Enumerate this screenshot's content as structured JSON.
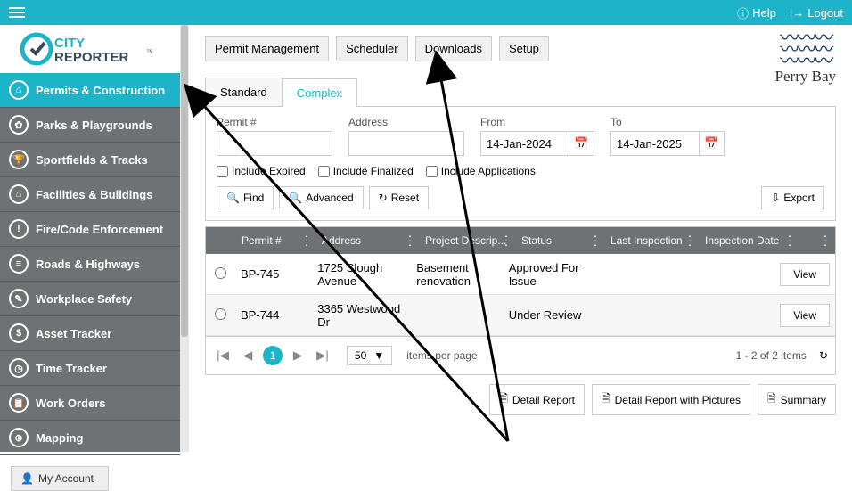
{
  "topbar": {
    "help": "Help",
    "logout": "Logout"
  },
  "brand": {
    "line1": "CITY",
    "line2": "REPORTER",
    "tm": "™"
  },
  "sidebar": {
    "items": [
      {
        "label": "Permits & Construction",
        "icon": "⌂",
        "active": true
      },
      {
        "label": "Parks & Playgrounds",
        "icon": "✿"
      },
      {
        "label": "Sportfields & Tracks",
        "icon": "🏆"
      },
      {
        "label": "Facilities & Buildings",
        "icon": "⌂"
      },
      {
        "label": "Fire/Code Enforcement",
        "icon": "!"
      },
      {
        "label": "Roads & Highways",
        "icon": "≡"
      },
      {
        "label": "Workplace Safety",
        "icon": "✎"
      },
      {
        "label": "Asset Tracker",
        "icon": "$"
      },
      {
        "label": "Time Tracker",
        "icon": "◷"
      },
      {
        "label": "Work Orders",
        "icon": "📋"
      },
      {
        "label": "Mapping",
        "icon": "⊕"
      }
    ],
    "my_account": "My Account"
  },
  "org": {
    "name": "Perry Bay"
  },
  "top_buttons": {
    "permit_mgmt": "Permit Management",
    "scheduler": "Scheduler",
    "downloads": "Downloads",
    "setup": "Setup"
  },
  "tabs": {
    "standard": "Standard",
    "complex": "Complex"
  },
  "filters": {
    "permit_label": "Permit #",
    "address_label": "Address",
    "from_label": "From",
    "to_label": "To",
    "from_value": "14-Jan-2024",
    "to_value": "14-Jan-2025",
    "include_expired": "Include Expired",
    "include_finalized": "Include Finalized",
    "include_applications": "Include Applications",
    "find": "Find",
    "advanced": "Advanced",
    "reset": "Reset",
    "export": "Export"
  },
  "grid": {
    "headers": {
      "permit": "Permit #",
      "address": "Address",
      "desc": "Project Descrip...",
      "status": "Status",
      "last": "Last Inspection",
      "insp": "Inspection Date"
    },
    "rows": [
      {
        "permit": "BP-745",
        "address": "1725 Slough Avenue",
        "desc": "Basement renovation",
        "status": "Approved For Issue",
        "last": "",
        "insp": "",
        "view": "View"
      },
      {
        "permit": "BP-744",
        "address": "3365 Westwood Dr",
        "desc": "",
        "status": "Under Review",
        "last": "",
        "insp": "",
        "view": "View"
      }
    ]
  },
  "pager": {
    "current": "1",
    "size": "50",
    "text": "items per page",
    "info": "1 - 2 of 2 items"
  },
  "bottom": {
    "detail": "Detail Report",
    "detail_pics": "Detail Report with Pictures",
    "summary": "Summary"
  }
}
